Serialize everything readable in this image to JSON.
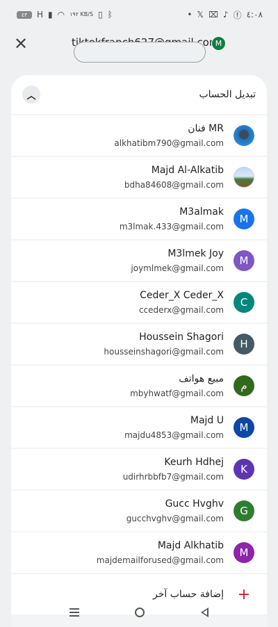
{
  "status": {
    "left": {
      "battery": "٤٣",
      "signal": "H",
      "speed": "١٩٢ KB/S"
    },
    "right": {
      "time": "٤:٠٨"
    }
  },
  "header": {
    "close_icon": "close-icon",
    "email": "tiktokfranch627@gmail.com",
    "avatar_letter": "M",
    "avatar_color": "#0b8043"
  },
  "panel": {
    "title": "تبديل الحساب",
    "collapse_icon": "chevron-up-icon"
  },
  "accounts": [
    {
      "name": "فنان MR",
      "email": "alkhatibm790@gmail.com",
      "avatar": "photo",
      "letter": ""
    },
    {
      "name": "Majd Al-Alkatib",
      "email": "bdha84608@gmail.com",
      "avatar": "photo",
      "letter": ""
    },
    {
      "name": "M3almak",
      "email": "m3lmak.433@gmail.com",
      "avatar": "letter",
      "letter": "M",
      "color": "#1a73e8"
    },
    {
      "name": "M3lmek Joy",
      "email": "joymlmek@gmail.com",
      "avatar": "letter",
      "letter": "M",
      "color": "#7e57c2"
    },
    {
      "name": "Ceder_X Ceder_X",
      "email": "ccederx@gmail.com",
      "avatar": "letter",
      "letter": "C",
      "color": "#00897b"
    },
    {
      "name": "Houssein Shagori",
      "email": "housseinshagori@gmail.com",
      "avatar": "letter",
      "letter": "H",
      "color": "#455a64"
    },
    {
      "name": "مبيع هواتف",
      "email": "mbyhwatf@gmail.com",
      "avatar": "letter",
      "letter": "م",
      "color": "#33691e"
    },
    {
      "name": "Majd U",
      "email": "majdu4853@gmail.com",
      "avatar": "letter",
      "letter": "M",
      "color": "#0d47a1"
    },
    {
      "name": "Keurh Hdhej",
      "email": "udirhrbbfb7@gmail.com",
      "avatar": "letter",
      "letter": "K",
      "color": "#5e35b1"
    },
    {
      "name": "Gucc Hvghv",
      "email": "gucchvghv@gmail.com",
      "avatar": "letter",
      "letter": "G",
      "color": "#2e7d32"
    },
    {
      "name": "Majd Alkhatib",
      "email": "majdemailforused@gmail.com",
      "avatar": "letter",
      "letter": "M",
      "color": "#8e24aa"
    }
  ],
  "add_account": {
    "label": "إضافة حساب آخر",
    "icon": "plus-icon"
  },
  "nav": {
    "menu_icon": "menu-icon",
    "home_icon": "home-icon",
    "back_icon": "back-icon"
  }
}
